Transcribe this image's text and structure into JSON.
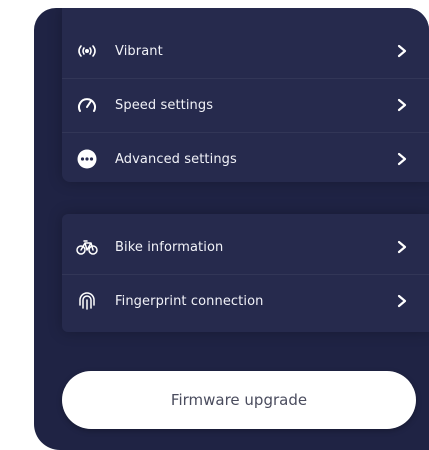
{
  "settings_group_1": [
    {
      "label": "Vibrant",
      "icon": "vibration-icon"
    },
    {
      "label": "Speed settings",
      "icon": "speedometer-icon"
    },
    {
      "label": "Advanced settings",
      "icon": "more-options-icon"
    }
  ],
  "settings_group_2": [
    {
      "label": "Bike information",
      "icon": "bike-icon"
    },
    {
      "label": "Fingerprint connection",
      "icon": "fingerprint-icon"
    }
  ],
  "firmware_button": {
    "label": "Firmware upgrade"
  },
  "colors": {
    "panel_bg": "#1f2344",
    "group_bg": "#262a4d",
    "text": "#f1f2f8",
    "button_bg": "#ffffff",
    "button_text": "#4a4c5e"
  }
}
